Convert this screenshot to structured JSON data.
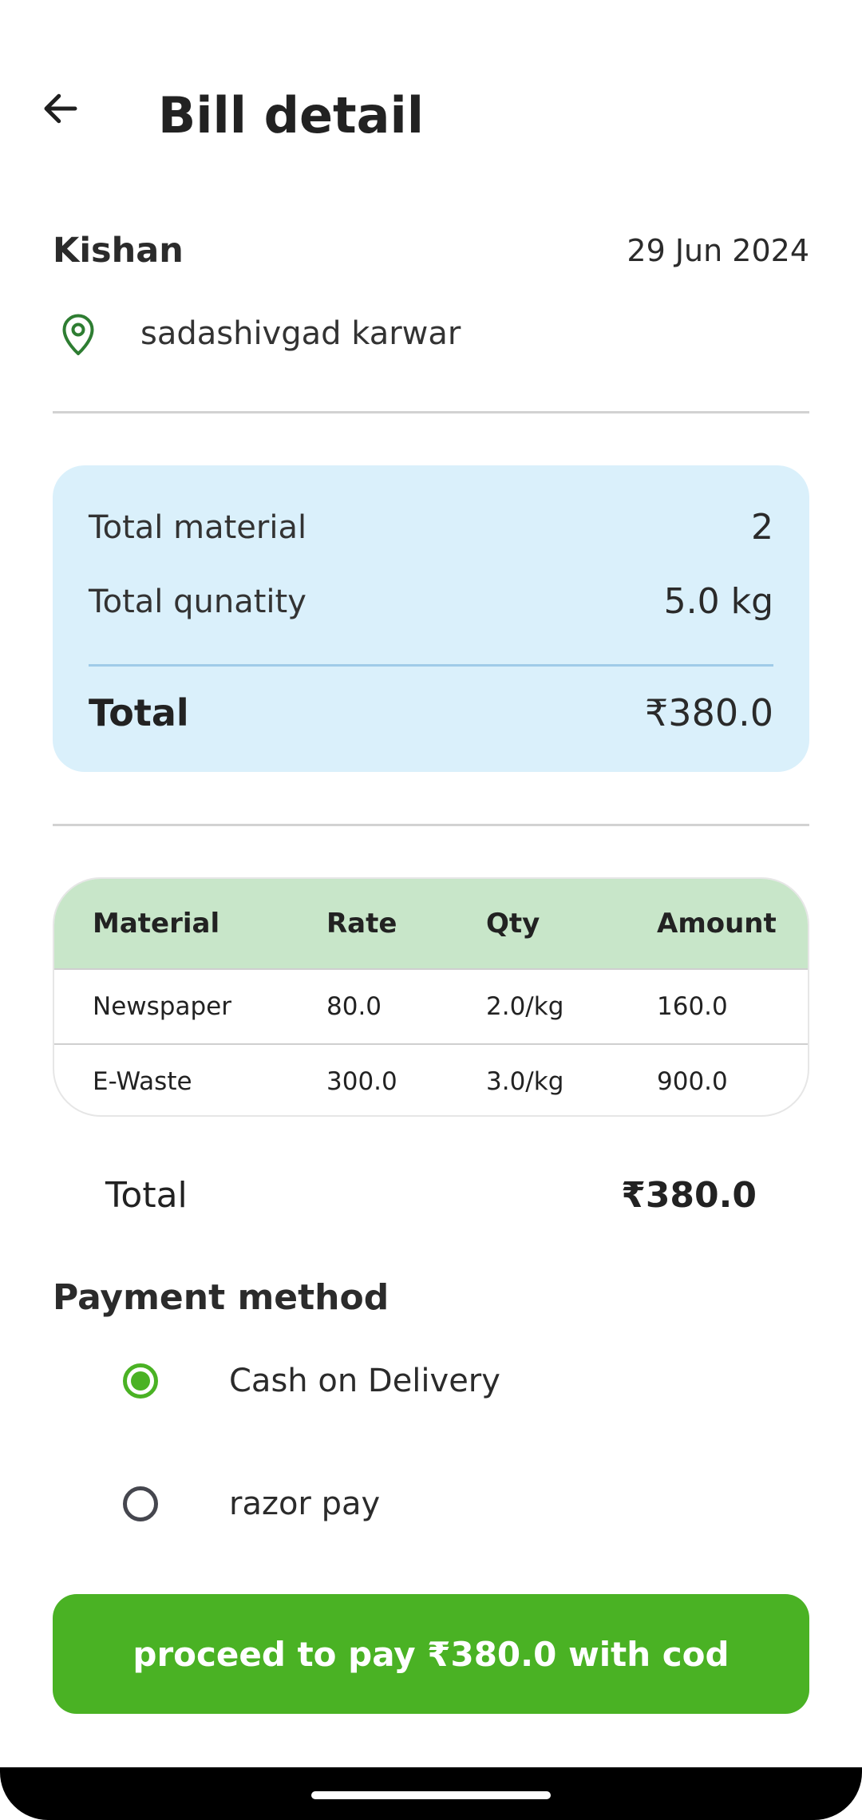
{
  "header": {
    "title": "Bill detail",
    "back_icon": "arrow-left-icon"
  },
  "customer": {
    "name": "Kishan",
    "date": "29 Jun 2024",
    "address": "sadashivgad karwar",
    "location_icon": "location-pin-icon"
  },
  "summary": {
    "total_material_label": "Total material",
    "total_material_value": "2",
    "total_quantity_label": "Total qunatity",
    "total_quantity_value": "5.0 kg",
    "total_label": "Total",
    "total_value": "₹380.0"
  },
  "table": {
    "headers": [
      "Material",
      "Rate",
      "Qty",
      "Amount"
    ],
    "rows": [
      [
        "Newspaper",
        "80.0",
        "2.0/kg",
        "160.0"
      ],
      [
        "E-Waste",
        "300.0",
        "3.0/kg",
        "900.0"
      ]
    ]
  },
  "grand_total": {
    "label": "Total",
    "value": "₹380.0"
  },
  "payment": {
    "heading": "Payment method",
    "options": [
      {
        "label": "Cash on Delivery",
        "selected": true
      },
      {
        "label": "razor pay",
        "selected": false
      }
    ]
  },
  "cta": {
    "label": "proceed to pay ₹380.0 with cod"
  },
  "colors": {
    "accent": "#4ab224",
    "summary_bg": "#daf0fb",
    "table_header_bg": "#c8e6c9"
  }
}
